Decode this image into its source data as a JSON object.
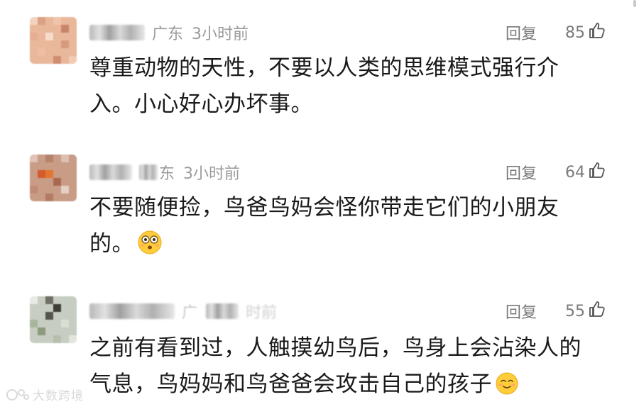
{
  "comments": [
    {
      "region": "广东",
      "time": "3小时前",
      "reply_label": "回复",
      "likes": "85",
      "text": "尊重动物的天性，不要以人类的思维模式强行介入。小心好心办坏事。"
    },
    {
      "region": "东",
      "time": "3小时前",
      "reply_label": "回复",
      "likes": "64",
      "text": "不要随便捡，鸟爸鸟妈会怪你带走它们的小朋友的。",
      "emoji": "flushed-face"
    },
    {
      "region": "广",
      "time": "时前",
      "reply_label": "回复",
      "likes": "55",
      "text": "之前有看到过，人触摸幼鸟后，鸟身上会沾染人的气息，鸟妈妈和鸟爸爸会攻击自己的孩子",
      "emoji": "smiling-face"
    }
  ],
  "watermark": {
    "text": "大数跨境"
  },
  "colors": {
    "meta_text": "#9b9b9b",
    "action_text": "#7a7a7a",
    "body_text": "#1a1a1a",
    "emoji_yellow": "#ffcd3c"
  }
}
